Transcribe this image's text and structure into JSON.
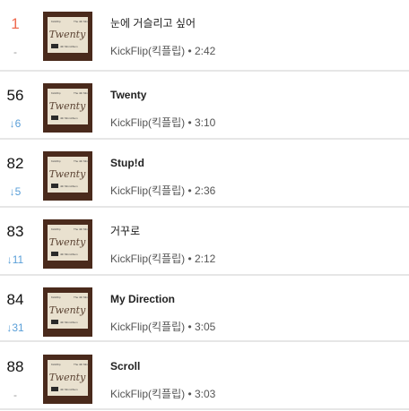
{
  "tracks": [
    {
      "rank": "1",
      "change": "-",
      "title": "눈에 거슬리고 싶어",
      "artist": "KickFlip(킥플립)",
      "duration": "2:42"
    },
    {
      "rank": "56",
      "change": "↓6",
      "title": "Twenty",
      "artist": "KickFlip(킥플립)",
      "duration": "3:10"
    },
    {
      "rank": "82",
      "change": "↓5",
      "title": "Stup!d",
      "artist": "KickFlip(킥플립)",
      "duration": "2:36"
    },
    {
      "rank": "83",
      "change": "↓11",
      "title": "거꾸로",
      "artist": "KickFlip(킥플립)",
      "duration": "2:12"
    },
    {
      "rank": "84",
      "change": "↓31",
      "title": "My Direction",
      "artist": "KickFlip(킥플립)",
      "duration": "3:05"
    },
    {
      "rank": "88",
      "change": "-",
      "title": "Scroll",
      "artist": "KickFlip(킥플립)",
      "duration": "3:03"
    }
  ],
  "album_art": {
    "label": "Twenty",
    "subtitle": "KickFlip 4th Mini Album",
    "icon": "album-cover-icon"
  },
  "colors": {
    "top_rank": "#ef6a4f",
    "rank_down": "#5a9fd8",
    "rank_same": "#9a9a9a",
    "divider": "#e6e6e6"
  }
}
